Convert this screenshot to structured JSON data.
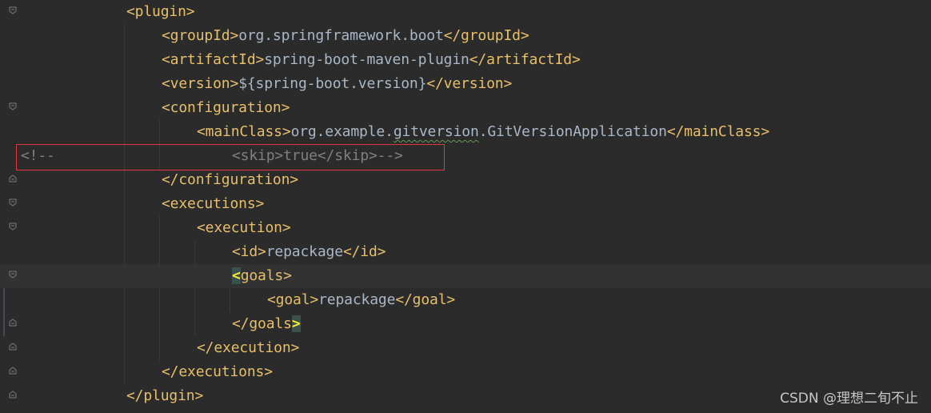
{
  "editor": {
    "lines": [
      {
        "id": "l1",
        "parts": [
          [
            "tag",
            "<plugin>"
          ]
        ]
      },
      {
        "id": "l2",
        "parts": [
          [
            "tag",
            "<groupId>"
          ],
          [
            "txt",
            "org.springframework.boot"
          ],
          [
            "tag",
            "</groupId>"
          ]
        ]
      },
      {
        "id": "l3",
        "parts": [
          [
            "tag",
            "<artifactId>"
          ],
          [
            "txt",
            "spring-boot-maven-plugin"
          ],
          [
            "tag",
            "</artifactId>"
          ]
        ]
      },
      {
        "id": "l4",
        "parts": [
          [
            "tag",
            "<version>"
          ],
          [
            "txt",
            "${spring-boot.version}"
          ],
          [
            "tag",
            "</version>"
          ]
        ]
      },
      {
        "id": "l5",
        "parts": [
          [
            "tag",
            "<configuration>"
          ]
        ]
      },
      {
        "id": "l6",
        "parts": [
          [
            "tag",
            "<mainClass>"
          ],
          [
            "txt",
            "org.example."
          ],
          [
            "sq",
            "gitversion"
          ],
          [
            "txt",
            ".GitVersionApplication"
          ],
          [
            "tag",
            "</mainClass>"
          ]
        ]
      },
      {
        "id": "l7a",
        "parts": [
          [
            "cmt",
            "<!--"
          ]
        ]
      },
      {
        "id": "l7b",
        "parts": [
          [
            "cmt",
            "<skip>true</skip>-->"
          ]
        ]
      },
      {
        "id": "l8",
        "parts": [
          [
            "tag",
            "</configuration>"
          ]
        ]
      },
      {
        "id": "l9",
        "parts": [
          [
            "tag",
            "<executions>"
          ]
        ]
      },
      {
        "id": "l10",
        "parts": [
          [
            "tag",
            "<execution>"
          ]
        ]
      },
      {
        "id": "l11",
        "parts": [
          [
            "tag",
            "<id>"
          ],
          [
            "txt",
            "repackage"
          ],
          [
            "tag",
            "</id>"
          ]
        ]
      },
      {
        "id": "l12",
        "parts": [
          [
            "bm",
            "<"
          ],
          [
            "tag",
            "goals>"
          ]
        ]
      },
      {
        "id": "l13",
        "parts": [
          [
            "tag",
            "<goal>"
          ],
          [
            "txt",
            "repackage"
          ],
          [
            "tag",
            "</goal>"
          ]
        ]
      },
      {
        "id": "l14",
        "parts": [
          [
            "tag",
            "</goals"
          ],
          [
            "bm",
            ">"
          ]
        ]
      },
      {
        "id": "l15",
        "parts": [
          [
            "tag",
            "</execution>"
          ]
        ]
      },
      {
        "id": "l16",
        "parts": [
          [
            "tag",
            "</executions>"
          ]
        ]
      },
      {
        "id": "l17",
        "parts": [
          [
            "tag",
            "</plugin>"
          ]
        ]
      }
    ]
  },
  "watermark": "CSDN @理想二旬不止",
  "colors": {
    "background": "#2b2b2b",
    "tag": "#e8bf6a",
    "text": "#a9b7c6",
    "comment": "#808080",
    "highlight_border": "#e0383e",
    "brace_match": "#3b514d"
  }
}
